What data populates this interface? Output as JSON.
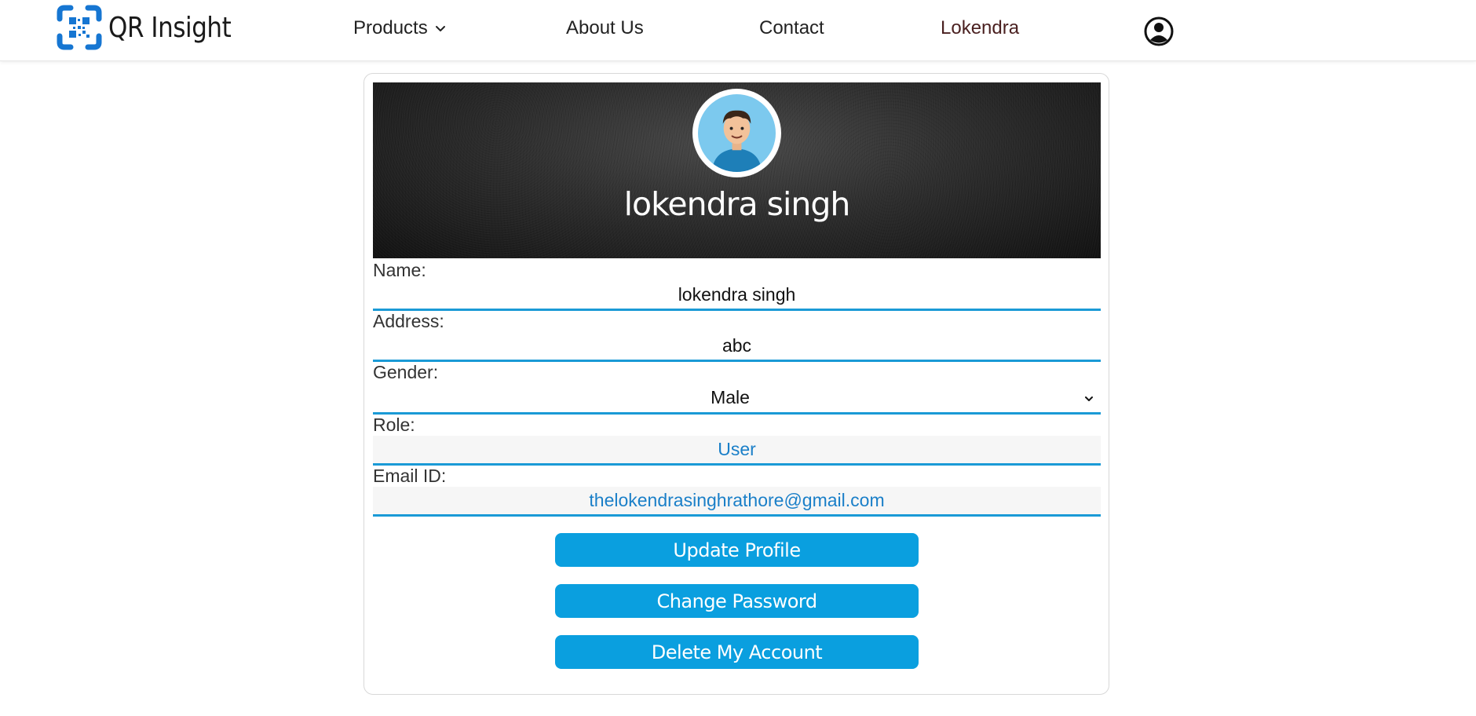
{
  "header": {
    "logo_text": "QR Insight",
    "nav": {
      "products": "Products",
      "about": "About Us",
      "contact": "Contact",
      "user": "Lokendra"
    }
  },
  "profile": {
    "display_name": "lokendra singh",
    "fields": {
      "name": {
        "label": "Name:",
        "value": "lokendra singh"
      },
      "address": {
        "label": "Address:",
        "value": "abc"
      },
      "gender": {
        "label": "Gender:",
        "value": "Male"
      },
      "role": {
        "label": "Role:",
        "value": "User"
      },
      "email": {
        "label": "Email ID:",
        "value": "thelokendrasinghrathore@gmail.com"
      }
    },
    "buttons": {
      "update": "Update Profile",
      "change_password": "Change Password",
      "delete": "Delete My Account"
    }
  },
  "colors": {
    "accent": "#0a9fdf",
    "underline": "#1a9ad6",
    "readonly_text": "#1a7fc8",
    "logo_blue": "#1676d2"
  },
  "icons": [
    "qr-logo-icon",
    "chevron-down-icon",
    "user-circle-icon",
    "avatar-icon"
  ]
}
